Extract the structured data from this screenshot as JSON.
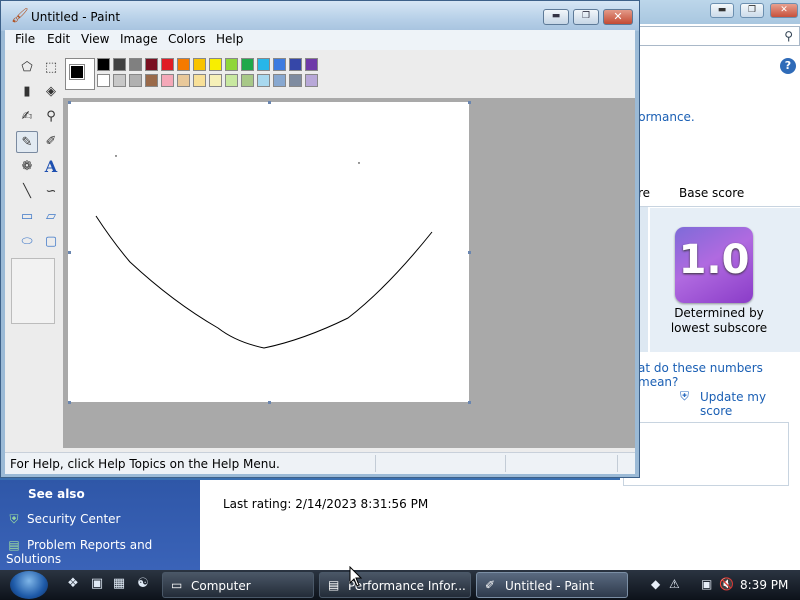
{
  "paint": {
    "title": "Untitled - Paint",
    "menu": [
      "File",
      "Edit",
      "View",
      "Image",
      "Colors",
      "Help"
    ],
    "status": "For Help, click Help Topics on the Help Menu.",
    "foreground_color": "#000000",
    "palette": [
      [
        "#000000",
        "#404040",
        "#808080",
        "#7a0f20",
        "#e01b24",
        "#f57a00",
        "#f8c300",
        "#f8ee00",
        "#8fd63a",
        "#1fa84b",
        "#27b6e8",
        "#3c7be0",
        "#3647a8",
        "#6f3aa8"
      ],
      [
        "#ffffff",
        "#c8c8c8",
        "#b0b0b0",
        "#9a6a4a",
        "#f4a8b8",
        "#e8c89a",
        "#f8e098",
        "#f6f0b8",
        "#c8e8a0",
        "#a8c888",
        "#a8d8ee",
        "#88a8d0",
        "#7f8ca0",
        "#b8a8d8"
      ]
    ],
    "tools": [
      "free-select-icon",
      "rect-select-icon",
      "eraser-icon",
      "fill-bucket-icon",
      "color-picker-icon",
      "magnifier-icon",
      "pencil-icon",
      "brush-icon",
      "airbrush-icon",
      "text-icon",
      "line-icon",
      "curve-icon",
      "rectangle-icon",
      "polygon-icon",
      "ellipse-icon",
      "rounded-rect-icon"
    ],
    "active_tool": "pencil-icon"
  },
  "background_window": {
    "link_performance": "formance.",
    "col_left": "re",
    "col_base_score": "Base score",
    "score": "1.0",
    "determined_line1": "Determined by",
    "determined_line2": "lowest subscore",
    "numbers_link": "at do these numbers mean?",
    "update_link": "Update my score",
    "last_rating": "Last rating: 2/14/2023 8:31:56 PM"
  },
  "see_also": {
    "title": "See also",
    "items": [
      "Security Center",
      "Problem Reports and Solutions"
    ]
  },
  "taskbar": {
    "tasks": [
      "Computer",
      "Performance Infor...",
      "Untitled - Paint"
    ],
    "active_task": "Untitled - Paint",
    "clock": "8:39 PM"
  }
}
